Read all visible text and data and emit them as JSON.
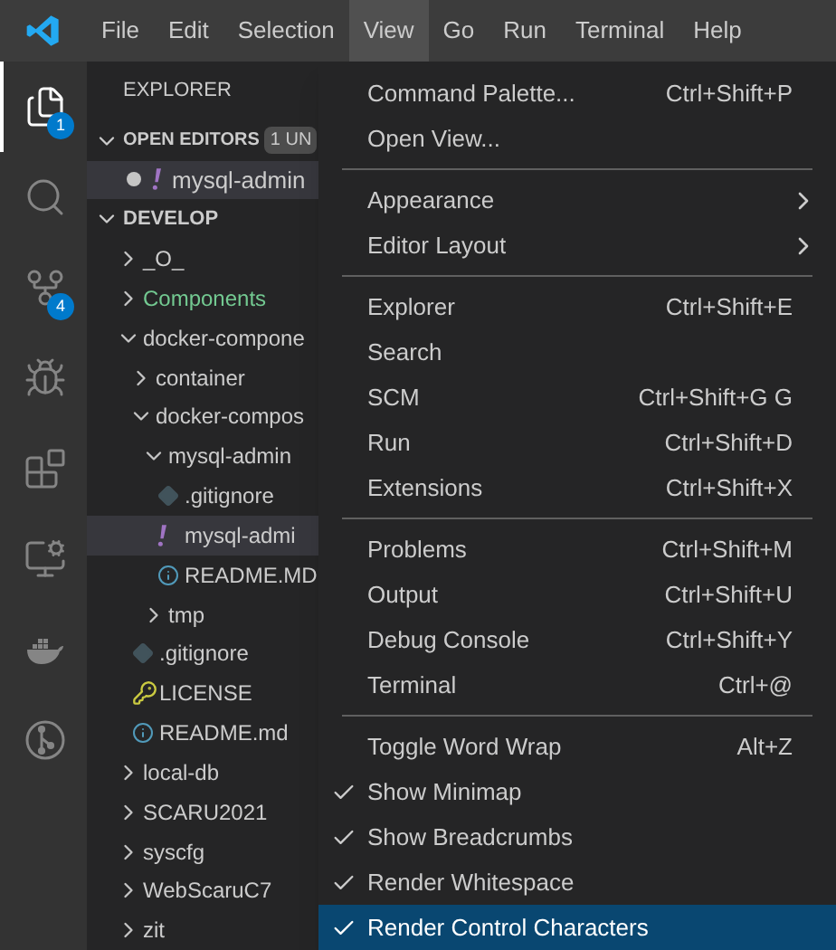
{
  "menubar": [
    {
      "label": "File",
      "selected": false
    },
    {
      "label": "Edit",
      "selected": false
    },
    {
      "label": "Selection",
      "selected": false
    },
    {
      "label": "View",
      "selected": true
    },
    {
      "label": "Go",
      "selected": false
    },
    {
      "label": "Run",
      "selected": false
    },
    {
      "label": "Terminal",
      "selected": false
    },
    {
      "label": "Help",
      "selected": false
    }
  ],
  "activity_bar": [
    {
      "kind": "files",
      "selected": true,
      "badge": "1"
    },
    {
      "kind": "search",
      "selected": false
    },
    {
      "kind": "source-control",
      "selected": false,
      "badge": "4"
    },
    {
      "kind": "run",
      "selected": false
    },
    {
      "kind": "extensions",
      "selected": false
    },
    {
      "kind": "remote",
      "selected": false
    },
    {
      "kind": "docker",
      "selected": false
    },
    {
      "kind": "git-graph",
      "selected": false
    }
  ],
  "sidebar": {
    "title": "EXPLORER",
    "open_editors": {
      "title": "OPEN EDITORS",
      "expanded": true,
      "badge": "1 UN",
      "items": [
        {
          "name": "mysql-admin",
          "modified": true,
          "selected": true,
          "kind": "yaml"
        }
      ]
    },
    "workspace": {
      "title": "DEVELOP",
      "expanded": true,
      "items": [
        {
          "name": "_O_",
          "kind": "folder",
          "expanded": false,
          "selected": false
        },
        {
          "name": "Components",
          "kind": "folder",
          "expanded": false,
          "selected": false,
          "color": "#73c991"
        },
        {
          "name": "docker-compone",
          "kind": "folder",
          "expanded": true,
          "selected": false,
          "children": [
            {
              "name": "container",
              "kind": "folder",
              "expanded": false,
              "selected": false
            },
            {
              "name": "docker-compos",
              "kind": "folder",
              "expanded": true,
              "selected": false,
              "children": [
                {
                  "name": "mysql-admin",
                  "kind": "folder",
                  "expanded": true,
                  "selected": false,
                  "children": [
                    {
                      "name": ".gitignore",
                      "kind": "gitignore",
                      "selected": false
                    },
                    {
                      "name": "mysql-admi",
                      "kind": "yaml",
                      "selected": true
                    },
                    {
                      "name": "README.MD",
                      "kind": "info",
                      "selected": false
                    }
                  ]
                },
                {
                  "name": "tmp",
                  "kind": "folder",
                  "expanded": false,
                  "selected": false
                }
              ]
            },
            {
              "name": ".gitignore",
              "kind": "gitignore",
              "selected": false
            },
            {
              "name": "LICENSE",
              "kind": "license",
              "selected": false
            },
            {
              "name": "README.md",
              "kind": "info",
              "selected": false
            }
          ]
        },
        {
          "name": "local-db",
          "kind": "folder",
          "expanded": false,
          "selected": false
        },
        {
          "name": "SCARU2021",
          "kind": "folder",
          "expanded": false,
          "selected": false
        },
        {
          "name": "syscfg",
          "kind": "folder",
          "expanded": false,
          "selected": false
        },
        {
          "name": "WebScaruC7",
          "kind": "folder",
          "expanded": false,
          "selected": false
        },
        {
          "name": "zit",
          "kind": "folder",
          "expanded": false,
          "selected": false
        }
      ]
    }
  },
  "view_menu": {
    "groups": [
      [
        {
          "label": "Command Palette...",
          "shortcut": "Ctrl+Shift+P",
          "submenu": false,
          "checked": false,
          "selected": false
        },
        {
          "label": "Open View...",
          "submenu": false,
          "checked": false,
          "selected": false
        }
      ],
      [
        {
          "label": "Appearance",
          "submenu": true,
          "checked": false,
          "selected": false
        },
        {
          "label": "Editor Layout",
          "submenu": true,
          "checked": false,
          "selected": false
        }
      ],
      [
        {
          "label": "Explorer",
          "shortcut": "Ctrl+Shift+E",
          "submenu": false,
          "checked": false,
          "selected": false
        },
        {
          "label": "Search",
          "submenu": false,
          "checked": false,
          "selected": false
        },
        {
          "label": "SCM",
          "shortcut": "Ctrl+Shift+G G",
          "submenu": false,
          "checked": false,
          "selected": false
        },
        {
          "label": "Run",
          "shortcut": "Ctrl+Shift+D",
          "submenu": false,
          "checked": false,
          "selected": false
        },
        {
          "label": "Extensions",
          "shortcut": "Ctrl+Shift+X",
          "submenu": false,
          "checked": false,
          "selected": false
        }
      ],
      [
        {
          "label": "Problems",
          "shortcut": "Ctrl+Shift+M",
          "submenu": false,
          "checked": false,
          "selected": false
        },
        {
          "label": "Output",
          "shortcut": "Ctrl+Shift+U",
          "submenu": false,
          "checked": false,
          "selected": false
        },
        {
          "label": "Debug Console",
          "shortcut": "Ctrl+Shift+Y",
          "submenu": false,
          "checked": false,
          "selected": false
        },
        {
          "label": "Terminal",
          "shortcut": "Ctrl+@",
          "submenu": false,
          "checked": false,
          "selected": false
        }
      ],
      [
        {
          "label": "Toggle Word Wrap",
          "shortcut": "Alt+Z",
          "submenu": false,
          "checked": false,
          "selected": false
        },
        {
          "label": "Show Minimap",
          "submenu": false,
          "checked": true,
          "selected": false
        },
        {
          "label": "Show Breadcrumbs",
          "submenu": false,
          "checked": true,
          "selected": false
        },
        {
          "label": "Render Whitespace",
          "submenu": false,
          "checked": true,
          "selected": false
        },
        {
          "label": "Render Control Characters",
          "submenu": false,
          "checked": true,
          "selected": true
        }
      ]
    ]
  }
}
